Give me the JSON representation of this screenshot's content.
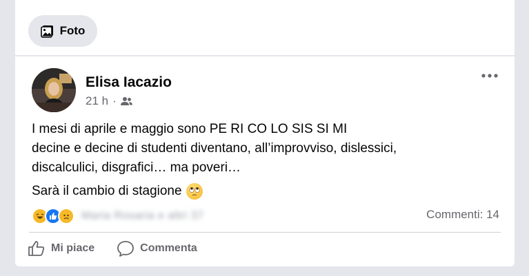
{
  "composer": {
    "photo_label": "Foto"
  },
  "post": {
    "author": "Elisa Iacazio",
    "time": "21 h",
    "meta_separator": "·",
    "lines": [
      "I mesi di aprile e maggio sono PE RI CO LO SIS SI MI",
      "decine e decine di studenti diventano, all’improvviso, dislessici,",
      "discalculici, disgrafici… ma poveri…",
      "Sarà il cambio di stagione"
    ],
    "reaction_names": "Maria Rosaria e altri 37",
    "comments_count": "Commenti: 14",
    "like_label": "Mi piace",
    "comment_label": "Commenta",
    "icons": {
      "photo": "photo-icon",
      "audience": "friends-icon",
      "more": "more-icon",
      "emoji": "rolling-eyes-emoji",
      "reactions": [
        "haha-reaction",
        "like-reaction",
        "sad-reaction"
      ],
      "like": "thumbs-up-icon",
      "comment": "comment-bubble-icon"
    }
  }
}
